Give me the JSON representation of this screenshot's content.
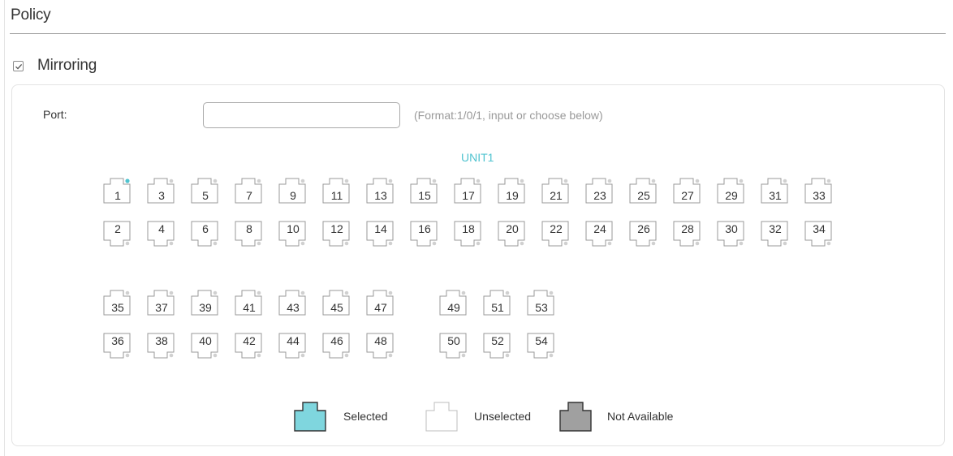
{
  "section_title": "Policy",
  "mirroring": {
    "label": "Mirroring",
    "checked": true
  },
  "port_field": {
    "label": "Port:",
    "value": "",
    "placeholder": "",
    "hint": "(Format:1/0/1, input or choose below)"
  },
  "unit_title": "UNIT1",
  "colors": {
    "accent": "#4fc3cf",
    "selected_fill": "#7fd6de",
    "not_available_fill": "#a0a0a0",
    "port_border": "#999999",
    "dot_default": "#d0d0d0"
  },
  "port_groups": [
    {
      "top": [
        "1",
        "3",
        "5",
        "7",
        "9",
        "11",
        "13",
        "15",
        "17",
        "19",
        "21",
        "23",
        "25",
        "27",
        "29",
        "31",
        "33"
      ],
      "bottom": [
        "2",
        "4",
        "6",
        "8",
        "10",
        "12",
        "14",
        "16",
        "18",
        "20",
        "22",
        "24",
        "26",
        "28",
        "30",
        "32",
        "34"
      ]
    },
    {
      "top": [
        "35",
        "37",
        "39",
        "41",
        "43",
        "45",
        "47"
      ],
      "bottom": [
        "36",
        "38",
        "40",
        "42",
        "44",
        "46",
        "48"
      ]
    },
    {
      "top": [
        "49",
        "51",
        "53"
      ],
      "bottom": [
        "50",
        "52",
        "54"
      ]
    }
  ],
  "active_ports": [
    "1"
  ],
  "legend": [
    {
      "state": "selected",
      "label": "Selected"
    },
    {
      "state": "unselected",
      "label": "Unselected"
    },
    {
      "state": "not-available",
      "label": "Not Available"
    }
  ]
}
